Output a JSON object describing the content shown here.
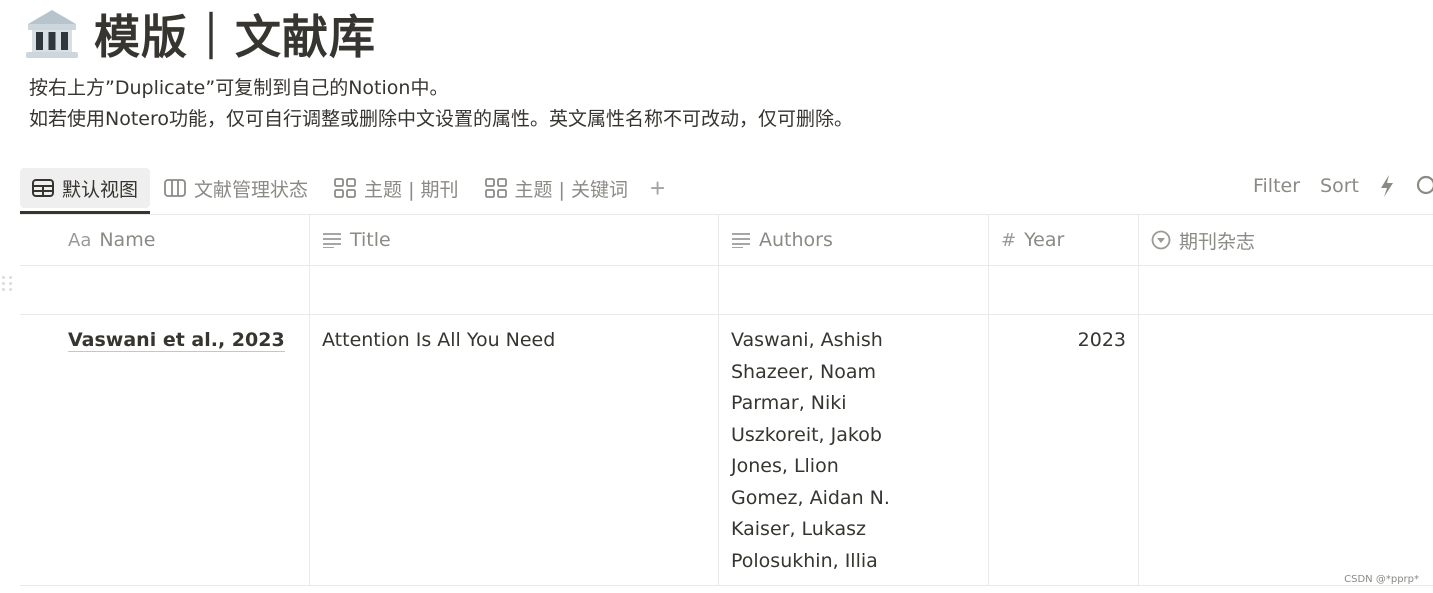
{
  "page": {
    "icon": "classical-building-icon",
    "title": "模版｜文献库",
    "description_lines": [
      "按右上方”Duplicate”可复制到自己的Notion中。",
      "如若使用Notero功能，仅可自行调整或删除中文设置的属性。英文属性名称不可改动，仅可删除。"
    ]
  },
  "views": {
    "tabs": [
      {
        "label": "默认视图",
        "icon": "table-icon",
        "active": true
      },
      {
        "label": "文献管理状态",
        "icon": "board-icon",
        "active": false
      },
      {
        "label": "主题 | 期刊",
        "icon": "gallery-icon",
        "active": false
      },
      {
        "label": "主题 | 关键词",
        "icon": "gallery-icon",
        "active": false
      }
    ],
    "add_label": "+"
  },
  "toolbar": {
    "filter_label": "Filter",
    "sort_label": "Sort",
    "automation_icon": "lightning-icon",
    "search_icon": "search-icon"
  },
  "table": {
    "columns": [
      {
        "label": "Name",
        "icon": "Aa"
      },
      {
        "label": "Title",
        "icon": "text-lines-icon"
      },
      {
        "label": "Authors",
        "icon": "text-lines-icon"
      },
      {
        "label": "Year",
        "icon": "#"
      },
      {
        "label": "期刊杂志",
        "icon": "select-icon"
      }
    ],
    "rows": [
      {
        "name": "",
        "title": "",
        "authors": [],
        "year": "",
        "journal": ""
      },
      {
        "name": "Vaswani et al., 2023",
        "title": "Attention Is All You Need",
        "authors": [
          "Vaswani, Ashish",
          "Shazeer, Noam",
          "Parmar, Niki",
          "Uszkoreit, Jakob",
          "Jones, Llion",
          "Gomez, Aidan N.",
          "Kaiser, Lukasz",
          "Polosukhin, Illia"
        ],
        "year": "2023",
        "journal": ""
      }
    ]
  },
  "watermark": "CSDN @*pprp*"
}
